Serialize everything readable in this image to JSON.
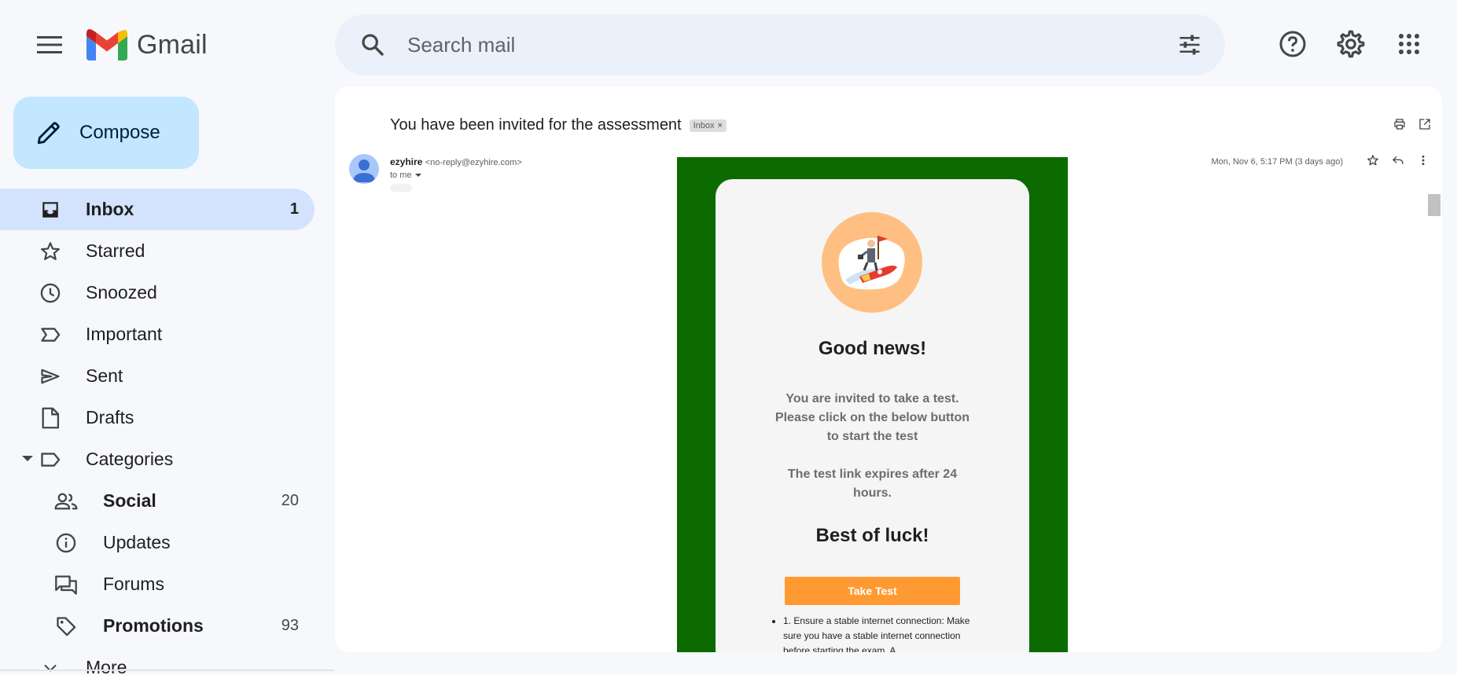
{
  "app": {
    "name": "Gmail"
  },
  "colors": {
    "accent": "#c2e7ff",
    "active_nav": "#d3e3fd",
    "email_frame": "#0b6b00",
    "cta": "#ff9a33",
    "illus_circle": "#ffbf82"
  },
  "header": {
    "search_placeholder": "Search mail",
    "icons": [
      "menu-icon",
      "search-icon",
      "tune-icon",
      "help-icon",
      "settings-icon",
      "apps-icon"
    ]
  },
  "sidebar": {
    "compose_label": "Compose",
    "items": [
      {
        "label": "Inbox",
        "count": "1",
        "icon": "inbox-icon"
      },
      {
        "label": "Starred",
        "count": "",
        "icon": "star-icon"
      },
      {
        "label": "Snoozed",
        "count": "",
        "icon": "clock-icon"
      },
      {
        "label": "Important",
        "count": "",
        "icon": "important-icon"
      },
      {
        "label": "Sent",
        "count": "",
        "icon": "send-icon"
      },
      {
        "label": "Drafts",
        "count": "",
        "icon": "draft-icon"
      },
      {
        "label": "Categories",
        "count": "",
        "icon": "label-icon"
      }
    ],
    "categories": [
      {
        "label": "Social",
        "count": "20",
        "icon": "people-icon"
      },
      {
        "label": "Updates",
        "count": "",
        "icon": "info-icon"
      },
      {
        "label": "Forums",
        "count": "",
        "icon": "forum-icon"
      },
      {
        "label": "Promotions",
        "count": "93",
        "icon": "tag-icon"
      }
    ],
    "more_label": "More"
  },
  "email": {
    "subject": "You have been invited for the assessment",
    "badge": "Inbox",
    "badge_close": "×",
    "sender_name": "ezyhire",
    "sender_email": "<no-reply@ezyhire.com>",
    "to": "to me",
    "date": "Mon, Nov 6, 5:17 PM (3 days ago)",
    "body": {
      "heading": "Good news!",
      "para1": "You are invited to take a test. Please click on the below button to start the test",
      "para2": "The test link expires after 24 hours.",
      "luck": "Best of luck!",
      "button": "Take Test",
      "tip1": "1. Ensure a stable internet connection: Make sure you have a stable internet connection before starting the exam. A"
    }
  }
}
